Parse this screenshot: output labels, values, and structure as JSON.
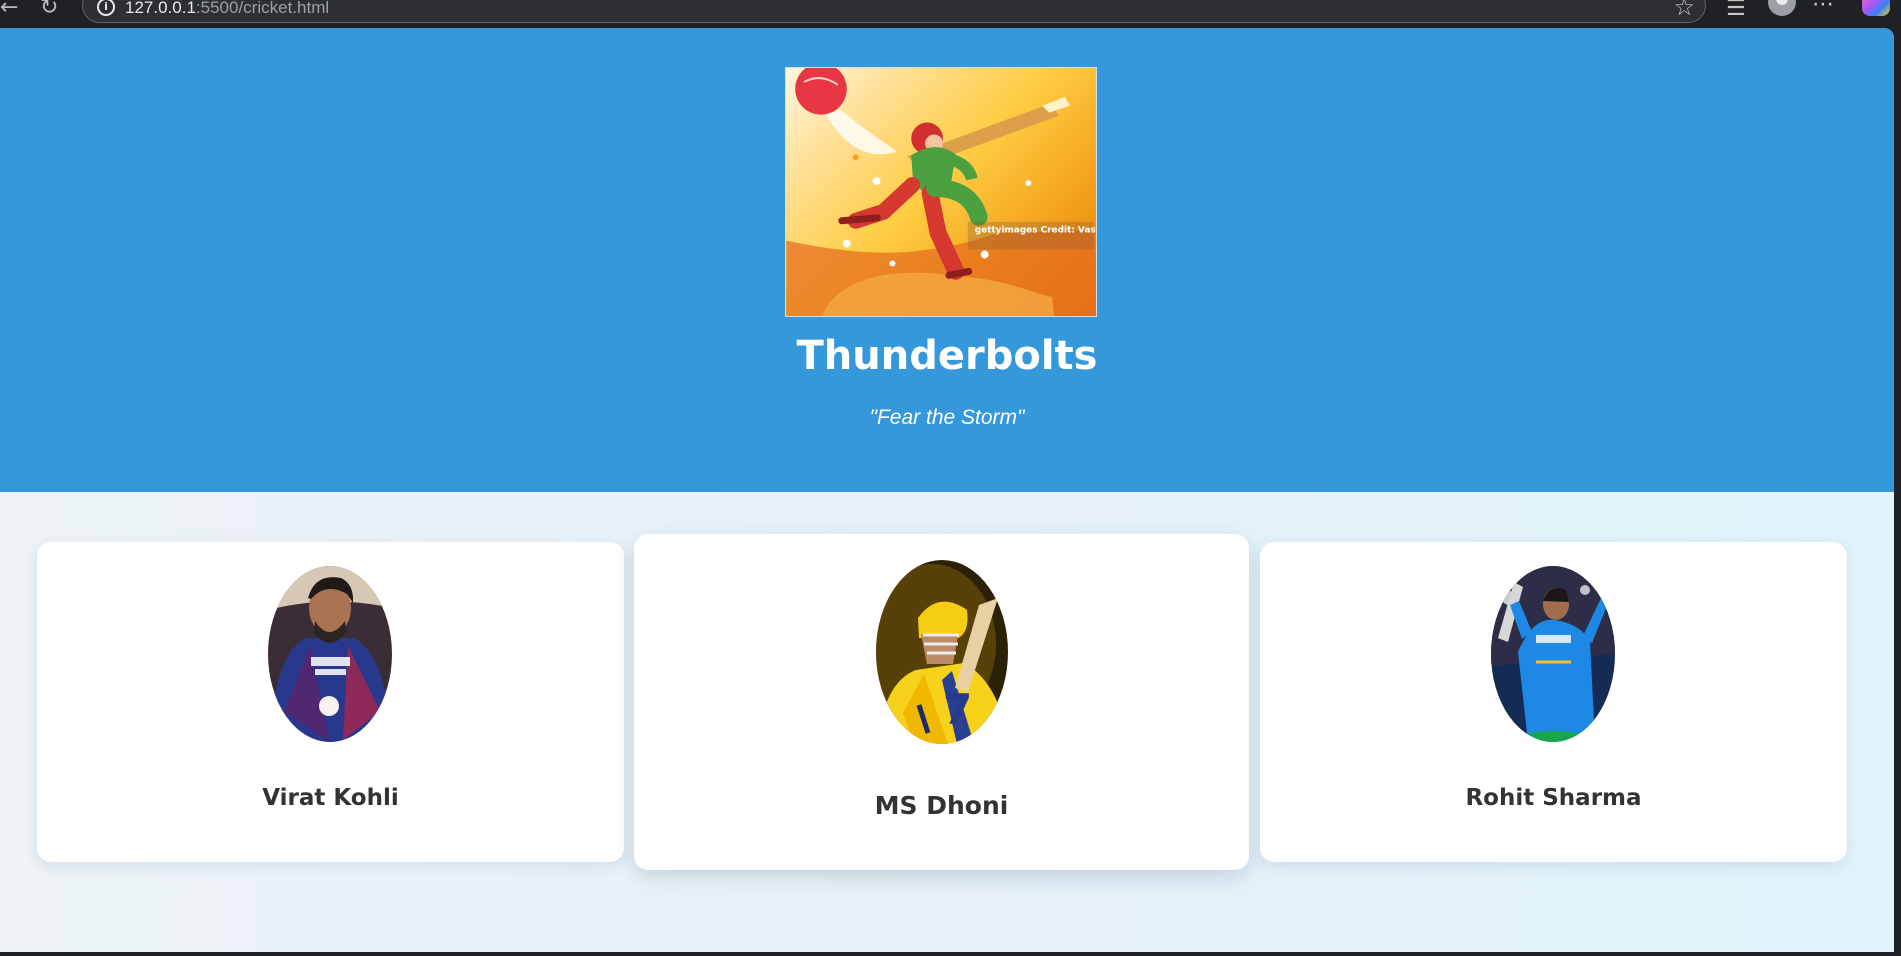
{
  "browser": {
    "url_host": "127.0.0.1",
    "url_path": ":5500/cricket.html",
    "icons": {
      "back": "back-arrow-icon",
      "reload": "reload-icon",
      "site_info": "info-icon",
      "favorite": "star-icon",
      "favorites_bar": "favorites-icon",
      "profile": "profile-icon",
      "menu": "more-options-icon",
      "copilot": "copilot-icon"
    }
  },
  "header": {
    "logo_alt": "cricket batsman illustration",
    "logo_credit": "gettyimages Credit: Vasilchenko",
    "team_name": "Thunderbolts",
    "motto": "\"Fear the Storm\""
  },
  "players": [
    {
      "name": "Virat Kohli",
      "image_alt": "Virat Kohli photo"
    },
    {
      "name": "MS Dhoni",
      "image_alt": "MS Dhoni photo"
    },
    {
      "name": "Rohit Sharma",
      "image_alt": "Rohit Sharma photo"
    }
  ],
  "colors": {
    "header_bg": "#3498db",
    "page_bg": "#f0f4f8",
    "card_bg": "#ffffff",
    "name_text": "#333333"
  }
}
